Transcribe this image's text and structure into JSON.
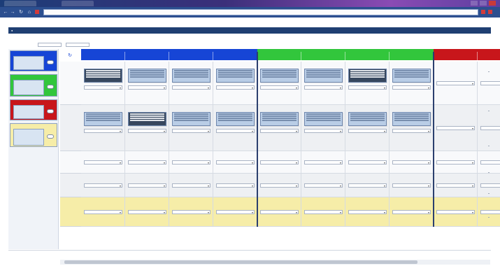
{
  "browser": {
    "tabs": [
      "",
      ""
    ],
    "url": ""
  },
  "app": {
    "title": "",
    "user_label": "",
    "menu": [
      "",
      "",
      "",
      "",
      "",
      ""
    ],
    "breadcrumb": "",
    "filter": {
      "label": "",
      "from_value": "",
      "to_value": ""
    }
  },
  "colors": {
    "blue": "#1645d6",
    "green": "#32c63c",
    "red": "#c8161b",
    "yellow": "#f6eda8",
    "navy": "#1f3f72",
    "card": "#b9cde6",
    "card_dark": "#37475e"
  },
  "left_panel": {
    "items": [
      {
        "color": "blue",
        "head": "",
        "text": ""
      },
      {
        "color": "green",
        "head": "",
        "text": ""
      },
      {
        "color": "red",
        "head": "",
        "text": ""
      },
      {
        "color": "yellow",
        "head": "",
        "text": ""
      }
    ]
  },
  "grid": {
    "groups": [
      {
        "color": "blue",
        "label": ""
      },
      {
        "color": "green",
        "label": ""
      },
      {
        "color": "red",
        "label": ""
      }
    ],
    "columns": [
      {
        "group": 0,
        "label": ""
      },
      {
        "group": 0,
        "label": ""
      },
      {
        "group": 0,
        "label": ""
      },
      {
        "group": 0,
        "label": ""
      },
      {
        "group": 1,
        "label": ""
      },
      {
        "group": 1,
        "label": ""
      },
      {
        "group": 1,
        "label": ""
      },
      {
        "group": 1,
        "label": ""
      },
      {
        "group": 2,
        "label": ""
      },
      {
        "group": 2,
        "label": ""
      }
    ],
    "rows": [
      {
        "label": "",
        "sub": ""
      },
      {
        "label": "",
        "sub": ""
      },
      {
        "label": "",
        "sub": ""
      },
      {
        "label": "",
        "sub": ""
      },
      {
        "label": "",
        "sub": ""
      }
    ],
    "cells": [
      [
        {
          "card": "dark",
          "select": ""
        },
        {
          "card": "light",
          "select": ""
        },
        {
          "card": "light",
          "select": ""
        },
        {
          "card": "light",
          "select": ""
        },
        {
          "card": "light",
          "select": ""
        },
        {
          "card": "light",
          "select": ""
        },
        {
          "card": "dark",
          "select": ""
        },
        {
          "card": "light",
          "select": ""
        },
        {
          "card": null,
          "select": ""
        },
        {
          "card": null,
          "select": ""
        }
      ],
      [
        {
          "card": "light",
          "select": ""
        },
        {
          "card": "dark",
          "select": ""
        },
        {
          "card": "light",
          "select": ""
        },
        {
          "card": "light",
          "select": ""
        },
        {
          "card": "light",
          "select": ""
        },
        {
          "card": "light",
          "select": ""
        },
        {
          "card": "light",
          "select": ""
        },
        {
          "card": "light",
          "select": ""
        },
        {
          "card": null,
          "select": ""
        },
        {
          "card": null,
          "select": ""
        }
      ],
      [
        {
          "card": null,
          "select": ""
        },
        {
          "card": null,
          "select": ""
        },
        {
          "card": null,
          "select": ""
        },
        {
          "card": null,
          "select": ""
        },
        {
          "card": null,
          "select": ""
        },
        {
          "card": null,
          "select": ""
        },
        {
          "card": null,
          "select": ""
        },
        {
          "card": null,
          "select": ""
        },
        {
          "card": null,
          "select": ""
        },
        {
          "card": null,
          "select": ""
        }
      ],
      [
        {
          "card": null,
          "select": ""
        },
        {
          "card": null,
          "select": ""
        },
        {
          "card": null,
          "select": ""
        },
        {
          "card": null,
          "select": ""
        },
        {
          "card": null,
          "select": ""
        },
        {
          "card": null,
          "select": ""
        },
        {
          "card": null,
          "select": ""
        },
        {
          "card": null,
          "select": ""
        },
        {
          "card": null,
          "select": ""
        },
        {
          "card": null,
          "select": ""
        }
      ],
      [
        {
          "card": null,
          "select": ""
        },
        {
          "card": null,
          "select": ""
        },
        {
          "card": null,
          "select": ""
        },
        {
          "card": null,
          "select": ""
        },
        {
          "card": null,
          "select": ""
        },
        {
          "card": null,
          "select": ""
        },
        {
          "card": null,
          "select": ""
        },
        {
          "card": null,
          "select": ""
        },
        {
          "card": null,
          "select": ""
        },
        {
          "card": null,
          "select": ""
        }
      ]
    ]
  }
}
